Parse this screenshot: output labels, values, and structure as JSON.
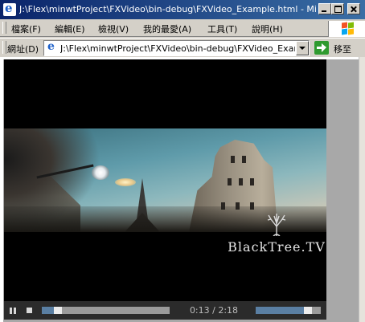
{
  "window": {
    "title": "J:\\Flex\\minwtProject\\FXVideo\\bin-debug\\FXVideo_Example.html - Microsoft Internet Explorer"
  },
  "menu": {
    "items": [
      {
        "label": "檔案(F)"
      },
      {
        "label": "編輯(E)"
      },
      {
        "label": "檢視(V)"
      },
      {
        "label": "我的最愛(A)"
      },
      {
        "label": "工具(T)"
      },
      {
        "label": "說明(H)"
      }
    ]
  },
  "address_bar": {
    "label": "網址(D)",
    "url": "J:\\Flex\\minwtProject\\FXVideo\\bin-debug\\FXVideo_Example.html",
    "go_label": "移至"
  },
  "player": {
    "watermark": "BlackTree.TV",
    "time_display": "0:13 / 2:18",
    "current_time": "0:13",
    "total_time": "2:18",
    "progress_fraction": 0.094,
    "volume_fraction": 0.81
  },
  "colors": {
    "titlebar_start": "#0a246a",
    "titlebar_end": "#3a6ea5",
    "player_background": "#000000",
    "control_bar": "#2b2b2b",
    "progress_accent": "#5a7fa3"
  },
  "icons": {
    "app": "ie-icon",
    "go": "go-arrow-icon",
    "play_pause": "pause-icon",
    "stop": "stop-icon"
  }
}
